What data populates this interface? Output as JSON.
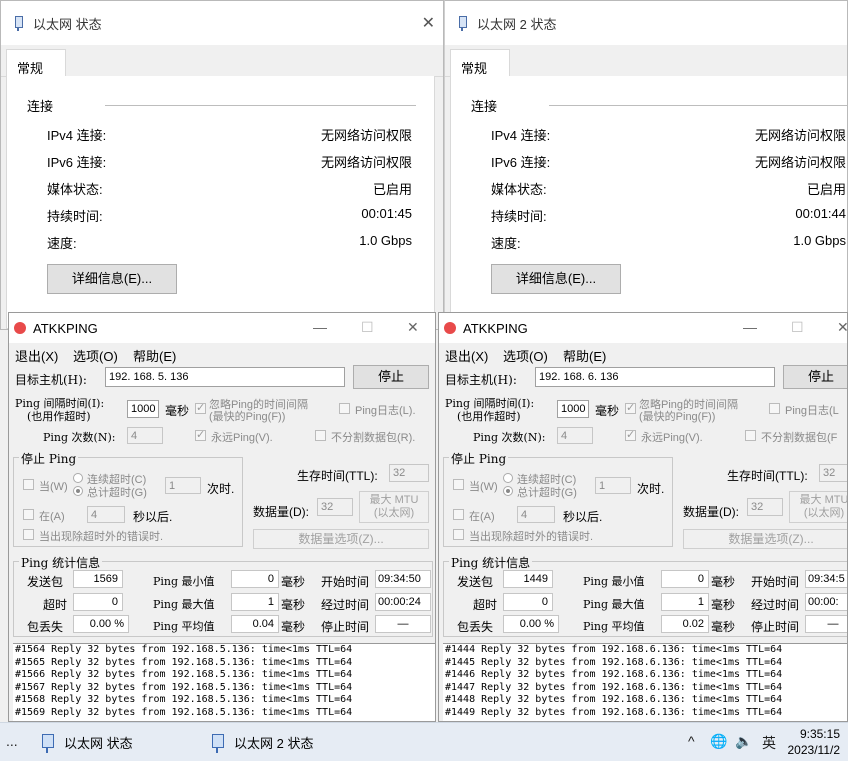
{
  "status_windows": [
    {
      "title": "以太网 状态",
      "tab": "常规",
      "section": "连接",
      "rows": [
        {
          "label": "IPv4 连接:",
          "value": "无网络访问权限"
        },
        {
          "label": "IPv6 连接:",
          "value": "无网络访问权限"
        },
        {
          "label": "媒体状态:",
          "value": "已启用"
        },
        {
          "label": "持续时间:",
          "value": "00:01:45"
        },
        {
          "label": "速度:",
          "value": "1.0 Gbps"
        }
      ],
      "details_button": "详细信息(E)..."
    },
    {
      "title": "以太网 2 状态",
      "tab": "常规",
      "section": "连接",
      "rows": [
        {
          "label": "IPv4 连接:",
          "value": "无网络访问权限"
        },
        {
          "label": "IPv6 连接:",
          "value": "无网络访问权限"
        },
        {
          "label": "媒体状态:",
          "value": "已启用"
        },
        {
          "label": "持续时间:",
          "value": "00:01:44"
        },
        {
          "label": "速度:",
          "value": "1.0 Gbps"
        }
      ],
      "details_button": "详细信息(E)..."
    }
  ],
  "ping_windows": [
    {
      "title": "ATKKPING",
      "menu": [
        "退出(X)",
        "选项(O)",
        "帮助(E)"
      ],
      "target_label": "目标主机(H):",
      "target_value": "192. 168. 5. 136",
      "stop_button": "停止",
      "interval_label_1": "Ping 间隔时间(I):",
      "interval_label_2": "(也用作超时)",
      "interval_value": "1000",
      "ms_unit": "毫秒",
      "ignore_interval_1": "忽略Ping的时间间隔",
      "ignore_interval_2": "(最快的Ping(F))",
      "ping_log": "Ping日志(L).",
      "count_label": "Ping 次数(N):",
      "count_value": "4",
      "forever": "永远Ping(V).",
      "no_fragment": "不分割数据包(R).",
      "stop_group": "停止 Ping",
      "when": "当(W)",
      "consecutive_timeout": "连续超时(C)",
      "total_timeout": "总计超时(G)",
      "timeout_value": "1",
      "times": "次时.",
      "at": "在(A)",
      "at_value": "4",
      "seconds_after": "秒以后.",
      "show_timeout_error": "当出现除超时外的错误时.",
      "ttl_label": "生存时间(TTL):",
      "ttl_value": "32",
      "data_label": "数据量(D):",
      "data_value": "32",
      "max_mtu_1": "最大 MTU",
      "max_mtu_2": "(以太网)",
      "data_options": "数据量选项(Z)...",
      "stats_title": "Ping  统计信息",
      "stats": {
        "sent_label": "发送包",
        "sent": "1569",
        "timeout_label": "超时",
        "timeout": "0",
        "loss_label": "包丢失",
        "loss": "0.00 %",
        "min_label": "Ping 最小值",
        "min": "0",
        "max_label": "Ping 最大值",
        "max": "1",
        "avg_label": "Ping 平均值",
        "avg": "0.04",
        "unit": "毫秒",
        "start_label": "开始时间",
        "start": "09:34:50",
        "elapsed_label": "经过时间",
        "elapsed": "00:00:24",
        "stop_label": "停止时间",
        "stop": "—"
      },
      "log": [
        "#1564 Reply 32 bytes from 192.168.5.136: time<1ms TTL=64",
        "#1565 Reply 32 bytes from 192.168.5.136: time<1ms TTL=64",
        "#1566 Reply 32 bytes from 192.168.5.136: time<1ms TTL=64",
        "#1567 Reply 32 bytes from 192.168.5.136: time<1ms TTL=64",
        "#1568 Reply 32 bytes from 192.168.5.136: time<1ms TTL=64",
        "#1569 Reply 32 bytes from 192.168.5.136: time<1ms TTL=64"
      ]
    },
    {
      "title": "ATKKPING",
      "menu": [
        "退出(X)",
        "选项(O)",
        "帮助(E)"
      ],
      "target_label": "目标主机(H):",
      "target_value": "192. 168. 6. 136",
      "stop_button": "停止",
      "interval_label_1": "Ping 间隔时间(I):",
      "interval_label_2": "(也用作超时)",
      "interval_value": "1000",
      "ms_unit": "毫秒",
      "ignore_interval_1": "忽略Ping的时间间隔",
      "ignore_interval_2": "(最快的Ping(F))",
      "ping_log": "Ping日志(L",
      "count_label": "Ping 次数(N):",
      "count_value": "4",
      "forever": "永远Ping(V).",
      "no_fragment": "不分割数据包(F",
      "stop_group": "停止 Ping",
      "when": "当(W)",
      "consecutive_timeout": "连续超时(C)",
      "total_timeout": "总计超时(G)",
      "timeout_value": "1",
      "times": "次时.",
      "at": "在(A)",
      "at_value": "4",
      "seconds_after": "秒以后.",
      "show_timeout_error": "当出现除超时外的错误时.",
      "ttl_label": "生存时间(TTL):",
      "ttl_value": "32",
      "data_label": "数据量(D):",
      "data_value": "32",
      "max_mtu_1": "最大 MTU",
      "max_mtu_2": "(以太网)",
      "data_options": "数据量选项(Z)...",
      "stats_title": "Ping  统计信息",
      "stats": {
        "sent_label": "发送包",
        "sent": "1449",
        "timeout_label": "超时",
        "timeout": "0",
        "loss_label": "包丢失",
        "loss": "0.00 %",
        "min_label": "Ping 最小值",
        "min": "0",
        "max_label": "Ping 最大值",
        "max": "1",
        "avg_label": "Ping 平均值",
        "avg": "0.02",
        "unit": "毫秒",
        "start_label": "开始时间",
        "start": "09:34:5",
        "elapsed_label": "经过时间",
        "elapsed": "00:00:",
        "stop_label": "停止时间",
        "stop": "—"
      },
      "log": [
        "#1444 Reply 32 bytes from 192.168.6.136: time<1ms TTL=64",
        "#1445 Reply 32 bytes from 192.168.6.136: time<1ms TTL=64",
        "#1446 Reply 32 bytes from 192.168.6.136: time<1ms TTL=64",
        "#1447 Reply 32 bytes from 192.168.6.136: time<1ms TTL=64",
        "#1448 Reply 32 bytes from 192.168.6.136: time<1ms TTL=64",
        "#1449 Reply 32 bytes from 192.168.6.136: time<1ms TTL=64"
      ]
    }
  ],
  "taskbar": {
    "overflow": "...",
    "items": [
      "以太网 状态",
      "以太网 2 状态"
    ],
    "tray": {
      "chevron": "^",
      "network_icon": "network-icon",
      "volume_icon": "volume-icon",
      "ime": "英"
    },
    "time": "9:35:15",
    "date": "2023/11/2"
  },
  "colors": {
    "ping_dot": "#e84a4a",
    "taskbar": "#e6ecf4"
  }
}
